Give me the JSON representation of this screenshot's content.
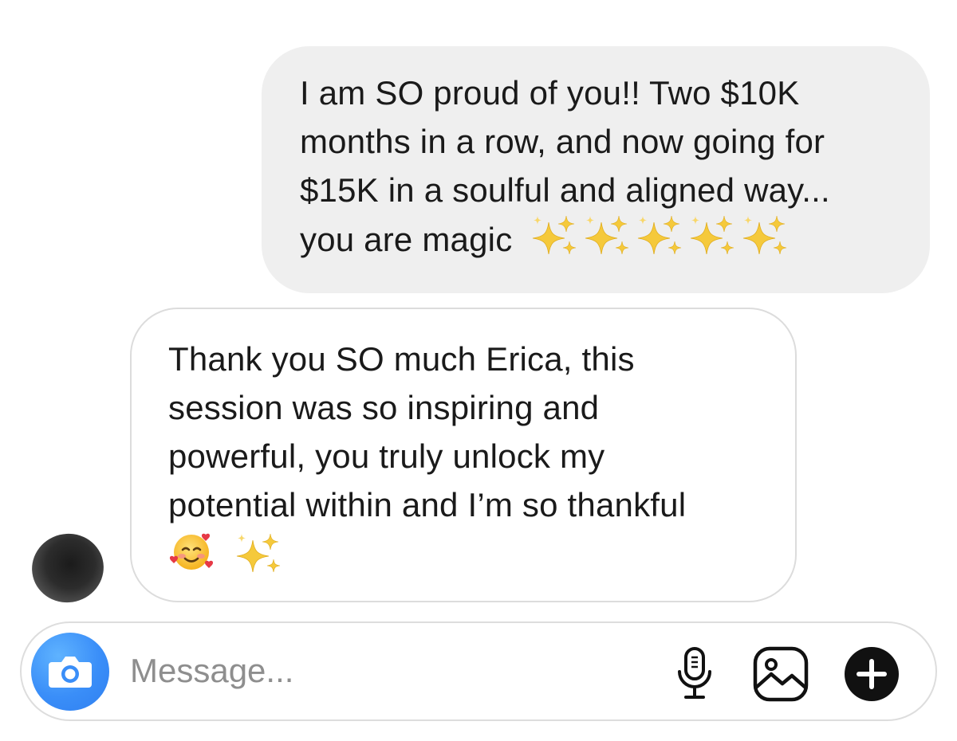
{
  "thread": {
    "sent_message": {
      "lines": [
        "I am SO proud of you!! Two $10K",
        "months in a row, and now going for",
        "$15K in a soulful and aligned way...",
        "you are magic"
      ],
      "trailing_emoji": "sparkles-icon x5"
    },
    "received_message": {
      "lines": [
        "Thank you SO much Erica, this",
        "session was so inspiring and",
        "powerful, you truly unlock my",
        "potential within and I’m so thankful"
      ],
      "trailing_emoji": "smiling-face-with-hearts, sparkles"
    },
    "avatar_icon": "avatar-blurred"
  },
  "composer": {
    "placeholder": "Message...",
    "value": "",
    "icons": {
      "camera": "camera-icon",
      "mic": "microphone-icon",
      "gallery": "image-icon",
      "more": "plus-circle-icon"
    }
  },
  "colors": {
    "sent_bubble": "#efefef",
    "received_border": "#dcdcdc",
    "camera_button": "#3a8ef8",
    "text": "#1a1a1a",
    "placeholder": "#8e8e8e",
    "gold_sparkle": "#f5c93b"
  }
}
